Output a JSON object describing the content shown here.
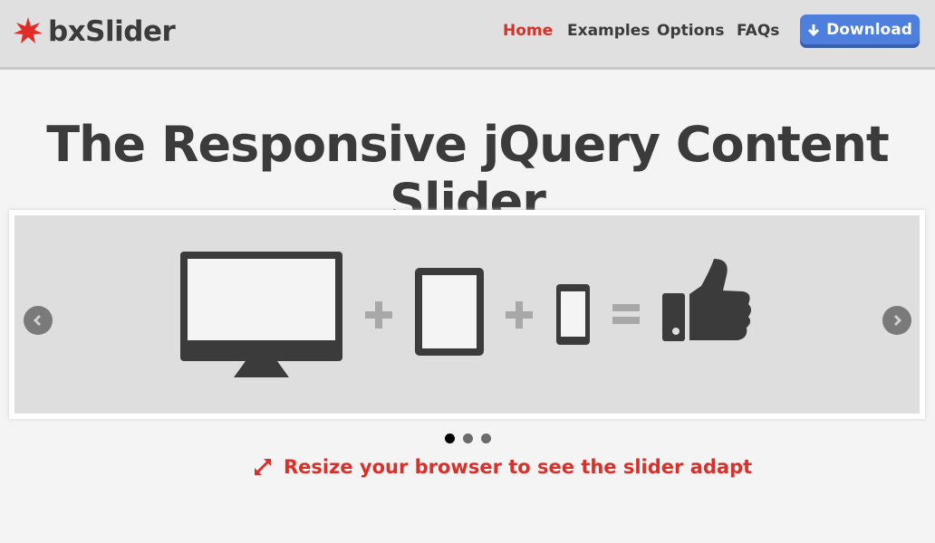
{
  "header": {
    "logo_text": "bxSlider",
    "nav": [
      {
        "label": "Home",
        "active": true
      },
      {
        "label": "Examples",
        "active": false
      },
      {
        "label": "Options",
        "active": false
      },
      {
        "label": "FAQs",
        "active": false
      }
    ],
    "download_label": "Download"
  },
  "hero": {
    "title": "The Responsive jQuery Content Slider"
  },
  "slider": {
    "slide_description": "monitor + tablet + phone = thumbs-up",
    "pager": {
      "total": 3,
      "current": 1
    }
  },
  "tagline": "Resize your browser to see the slider adapt",
  "colors": {
    "accent_red": "#d8302b",
    "download_blue": "#4e7fdc",
    "text_dark": "#3b3b3b"
  }
}
